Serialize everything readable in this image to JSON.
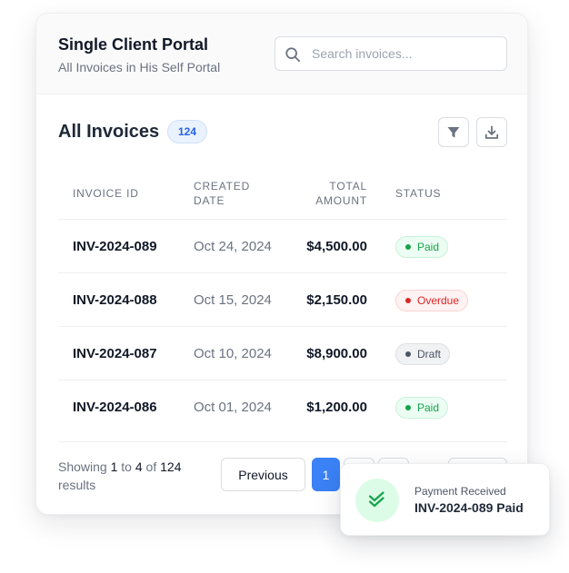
{
  "header": {
    "title": "Single Client Portal",
    "subtitle": "All Invoices in His Self Portal",
    "search_placeholder": "Search invoices..."
  },
  "section": {
    "title": "All Invoices",
    "count": "124"
  },
  "table": {
    "columns": {
      "invoice_id": "INVOICE ID",
      "created_date_line1": "CREATED",
      "created_date_line2": "DATE",
      "total_amount_line1": "TOTAL",
      "total_amount_line2": "AMOUNT",
      "status": "STATUS"
    },
    "rows": [
      {
        "id": "INV-2024-089",
        "date": "Oct 24, 2024",
        "amount": "$4,500.00",
        "status": "Paid"
      },
      {
        "id": "INV-2024-088",
        "date": "Oct 15, 2024",
        "amount": "$2,150.00",
        "status": "Overdue"
      },
      {
        "id": "INV-2024-087",
        "date": "Oct 10, 2024",
        "amount": "$8,900.00",
        "status": "Draft"
      },
      {
        "id": "INV-2024-086",
        "date": "Oct 01, 2024",
        "amount": "$1,200.00",
        "status": "Paid"
      }
    ]
  },
  "pagination": {
    "showing_prefix": "Showing",
    "from": "1",
    "to_word": "to",
    "to": "4",
    "of_word": "of",
    "total": "124",
    "results_word": "results",
    "previous_label": "Previous",
    "current_page": "1"
  },
  "toast": {
    "label": "Payment Received",
    "title": "INV-2024-089 Paid"
  },
  "icons": {
    "search": "search-icon",
    "filter": "filter-icon",
    "download": "download-icon",
    "check": "double-check-icon"
  },
  "colors": {
    "accent": "#3b82f6",
    "paid": "#16a34a",
    "overdue": "#dc2626",
    "draft": "#4b5563",
    "toast_icon_bg": "#dcfce7"
  }
}
